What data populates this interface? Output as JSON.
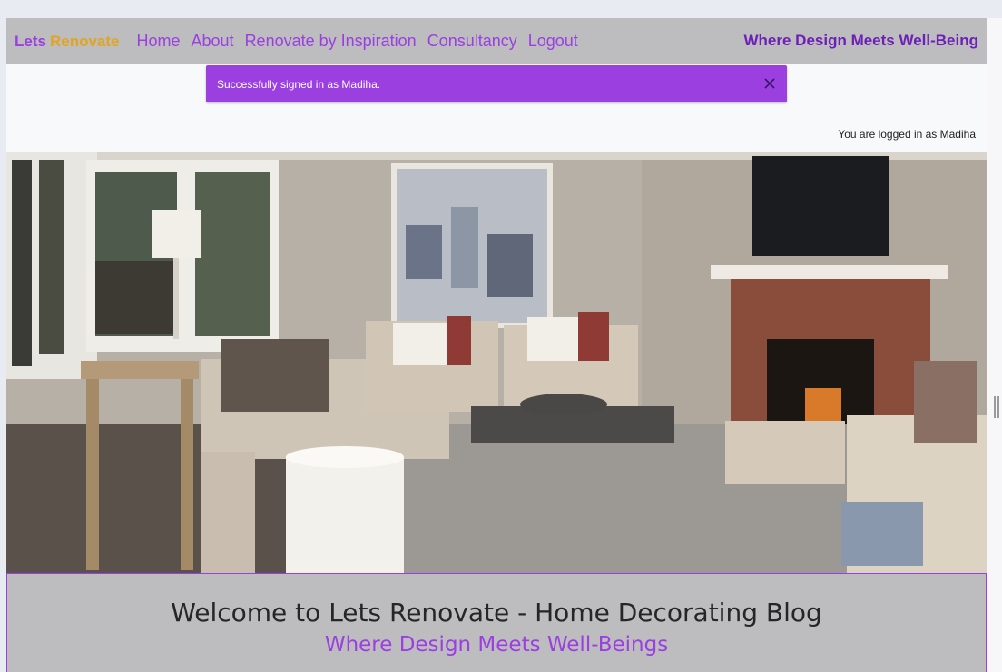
{
  "navbar": {
    "brand_part1": "Lets",
    "brand_part2": "Renovate",
    "links": [
      "Home",
      "About",
      "Renovate by Inspiration",
      "Consultancy",
      "Logout"
    ],
    "tagline": "Where Design Meets Well-Being"
  },
  "alert": {
    "message": "Successfully signed in as Madiha.",
    "close_icon": "close-icon"
  },
  "status": {
    "logged_in": "You are logged in as Madiha"
  },
  "hero": {
    "image_icon": "living-room-photo"
  },
  "welcome": {
    "title": "Welcome to Lets Renovate - Home Decorating Blog",
    "subtitle": "Where Design Meets Well-Beings",
    "body": ""
  },
  "colors": {
    "brand_purple": "#9a3fe0",
    "brand_gold": "#e0a521",
    "navbar_bg": "#bdbcbe",
    "alert_bg": "#9b3fe1"
  }
}
